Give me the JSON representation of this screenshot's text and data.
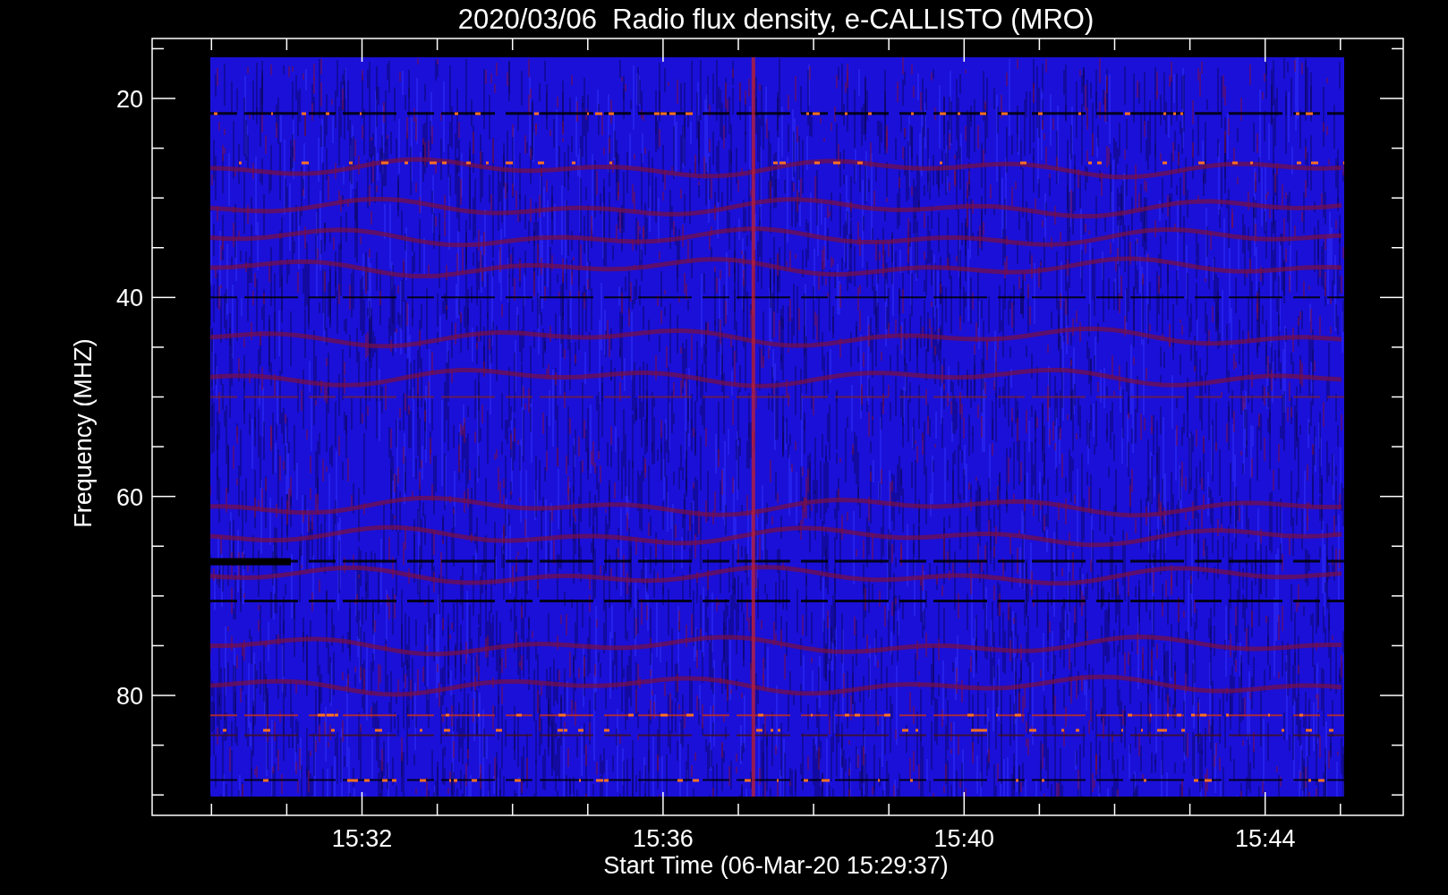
{
  "plot": {
    "title": "2020/03/06  Radio flux density, e-CALLISTO (MRO)",
    "ylabel": "Frequency (MHZ)",
    "xlabel": "Start Time (06-Mar-20 15:29:37)",
    "yticks": [
      "20",
      "40",
      "60",
      "80"
    ],
    "xticks": [
      "15:32",
      "15:36",
      "15:40",
      "15:44"
    ]
  }
}
